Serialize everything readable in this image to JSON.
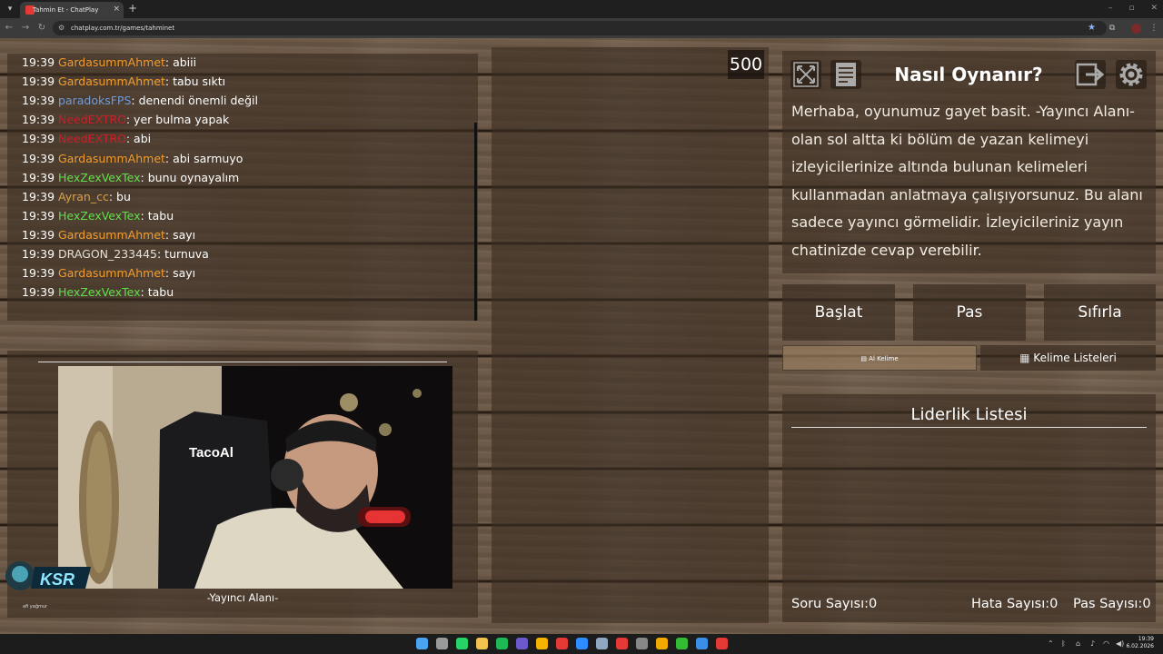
{
  "browser": {
    "tab_title": "Tahmin Et - ChatPlay",
    "tab_close": "×",
    "new_tab": "+",
    "url": "chatplay.com.tr/games/tahminet",
    "icons": [
      "tab-menu-icon",
      "back-arrow-icon",
      "forward-arrow-icon",
      "reload-icon",
      "site-info-icon",
      "bookmark-star-icon",
      "extensions-icon",
      "profile-avatar-icon",
      "browser-menu-icon",
      "minimize-icon",
      "maximize-icon",
      "close-icon"
    ]
  },
  "chat": {
    "messages": [
      {
        "time": "19:39",
        "user": "GardasummAhmet",
        "color": "#f39c2b",
        "text": ": abiii"
      },
      {
        "time": "19:39",
        "user": "GardasummAhmet",
        "color": "#f39c2b",
        "text": ": tabu sıktı"
      },
      {
        "time": "19:39",
        "user": "paradoksFPS",
        "color": "#6f9bd8",
        "text": ": denendi önemli değil"
      },
      {
        "time": "19:39",
        "user": "NeedEXTRO",
        "color": "#c8202a",
        "text": ": yer bulma yapak"
      },
      {
        "time": "19:39",
        "user": "NeedEXTRO",
        "color": "#c8202a",
        "text": ": abi"
      },
      {
        "time": "19:39",
        "user": "GardasummAhmet",
        "color": "#f39c2b",
        "text": ": abi sarmuyo"
      },
      {
        "time": "19:39",
        "user": "HexZexVexTex",
        "color": "#5fe04a",
        "text": ": bunu oynayalım"
      },
      {
        "time": "19:39",
        "user": "Ayran_cc",
        "color": "#d9a04a",
        "text": ": bu"
      },
      {
        "time": "19:39",
        "user": "HexZexVexTex",
        "color": "#5fe04a",
        "text": ": tabu"
      },
      {
        "time": "19:39",
        "user": "GardasummAhmet",
        "color": "#f39c2b",
        "text": ": sayı"
      },
      {
        "time": "19:39",
        "user": "DRAGON_233445",
        "color": "#e6e0d8",
        "text": ": turnuva"
      },
      {
        "time": "19:39",
        "user": "GardasummAhmet",
        "color": "#f39c2b",
        "text": ": sayı"
      },
      {
        "time": "19:39",
        "user": "HexZexVexTex",
        "color": "#5fe04a",
        "text": ": tabu"
      }
    ]
  },
  "streamer": {
    "label": "-Yayıncı Alanı-",
    "camera_overlay_text": "TacoAl"
  },
  "game": {
    "points": "500"
  },
  "howto": {
    "title": "Nasıl Oynanır?",
    "body": "Merhaba, oyunumuz gayet basit. -Yayıncı Alanı- olan sol altta ki bölüm de yazan kelimeyi izleyicilerinize altında bulunan kelimeleri kullanmadan anlatmaya çalışıyorsunuz. Bu alanı sadece yayıncı görmelidir. İzleyicileriniz yayın chatinizde cevap verebilir.",
    "icons": [
      "fullscreen-icon",
      "document-icon",
      "exit-icon",
      "settings-gear-icon"
    ]
  },
  "actions": {
    "start": "Başlat",
    "pass": "Pas",
    "reset": "Sıfırla",
    "get_word": "Al Kelime",
    "word_lists": "Kelime Listeleri"
  },
  "leaderboard": {
    "title": "Liderlik Listesi",
    "questions_label": "Soru Sayısı:",
    "questions_value": "0",
    "errors_label": "Hata Sayısı:",
    "errors_value": "0",
    "passes_label": "Pas Sayısı:",
    "passes_value": "0"
  },
  "watermark": {
    "logo_text": "KSR",
    "caption": "afi yağmur"
  },
  "taskbar": {
    "icons": [
      "windows-start-icon",
      "task-view-icon",
      "whatsapp-icon",
      "file-explorer-icon",
      "spotify-icon",
      "app-icon",
      "chrome-icon",
      "opera-icon",
      "edge-icon",
      "steam-icon",
      "youtube-icon",
      "settings-icon",
      "app-icon",
      "xbox-icon",
      "store-icon",
      "chrome-active-icon"
    ],
    "time": "19:39",
    "date": "6.02.2026"
  },
  "colors": {
    "wood": "#6e5a48",
    "panel": "#3a2d22",
    "accent_orange": "#f39c2b",
    "accent_green": "#5fe04a"
  }
}
